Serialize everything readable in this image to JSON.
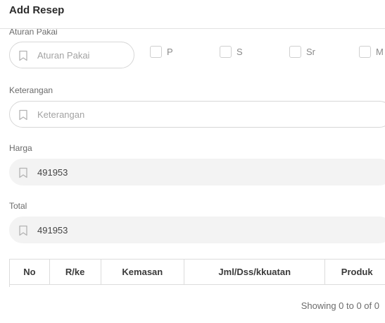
{
  "header": {
    "title": "Add Resep"
  },
  "aturan_pakai": {
    "label": "Aturan Pakai",
    "placeholder": "Aturan Pakai",
    "options": [
      {
        "label": "P"
      },
      {
        "label": "S"
      },
      {
        "label": "Sr"
      },
      {
        "label": "M"
      }
    ]
  },
  "keterangan": {
    "label": "Keterangan",
    "placeholder": "Keterangan"
  },
  "harga": {
    "label": "Harga",
    "value": "491953"
  },
  "total": {
    "label": "Total",
    "value": "491953"
  },
  "table": {
    "columns": [
      "No",
      "R/ke",
      "Kemasan",
      "Jml/Dss/kkuatan",
      "Produk"
    ]
  },
  "footer": {
    "info": "Showing 0 to 0 of 0"
  },
  "icons": {
    "field": "bookmark-icon"
  },
  "colors": {
    "border": "#d7d7d7",
    "filled_bg": "#f3f3f3",
    "muted_text": "#a3a3a3"
  }
}
